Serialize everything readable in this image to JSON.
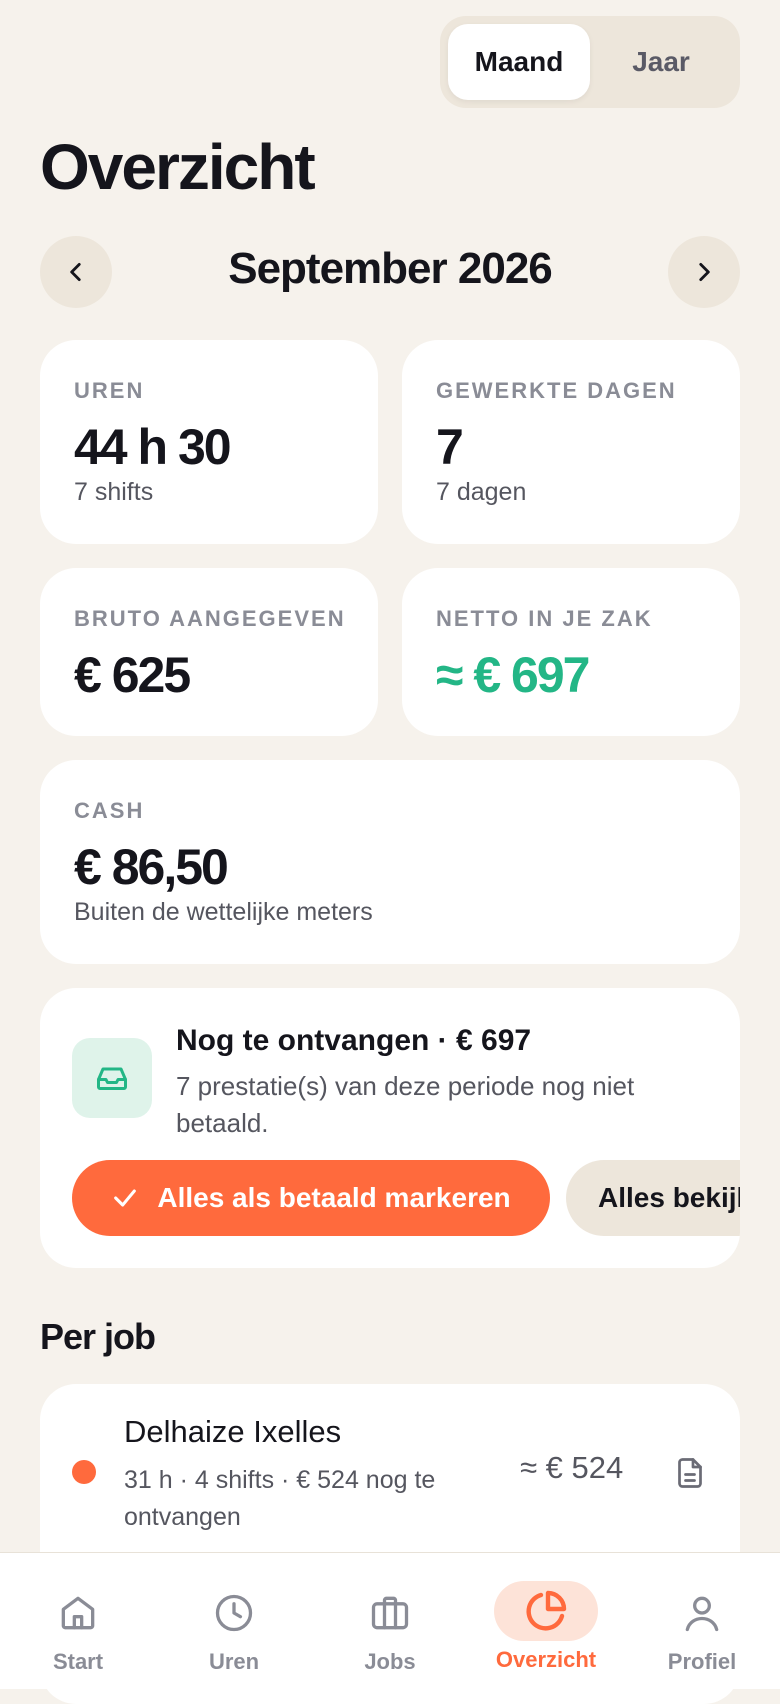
{
  "segment": {
    "month": "Maand",
    "year": "Jaar"
  },
  "page_title": "Overzicht",
  "period": "September 2026",
  "stats": {
    "hours": {
      "label": "UREN",
      "value": "44 h 30",
      "sub": "7 shifts"
    },
    "days": {
      "label": "GEWERKTE DAGEN",
      "value": "7",
      "sub": "7 dagen"
    },
    "gross": {
      "label": "BRUTO AANGEGEVEN",
      "value": "€ 625"
    },
    "net": {
      "label": "NETTO IN JE ZAK",
      "value": "≈ € 697"
    },
    "cash": {
      "label": "CASH",
      "value": "€ 86,50",
      "sub": "Buiten de wettelijke meters"
    }
  },
  "pending": {
    "title": "Nog te ontvangen · € 697",
    "description": "7 prestatie(s) van deze periode nog niet betaald.",
    "mark_paid": "Alles als betaald markeren",
    "view_all": "Alles bekijken"
  },
  "per_job": {
    "title": "Per job",
    "jobs": [
      {
        "name": "Delhaize Ixelles",
        "meta": "31 h · 4 shifts · € 524 nog te ontvangen",
        "amount": "≈ € 524",
        "color": "#ff6a3d"
      }
    ]
  },
  "tabs": [
    {
      "label": "Start",
      "icon": "home-icon"
    },
    {
      "label": "Uren",
      "icon": "clock-icon"
    },
    {
      "label": "Jobs",
      "icon": "briefcase-icon"
    },
    {
      "label": "Overzicht",
      "icon": "pie-chart-icon",
      "active": true
    },
    {
      "label": "Profiel",
      "icon": "user-icon"
    }
  ],
  "colors": {
    "accent": "#ff6a3d",
    "positive": "#23b686",
    "background": "#f6f2ec"
  }
}
